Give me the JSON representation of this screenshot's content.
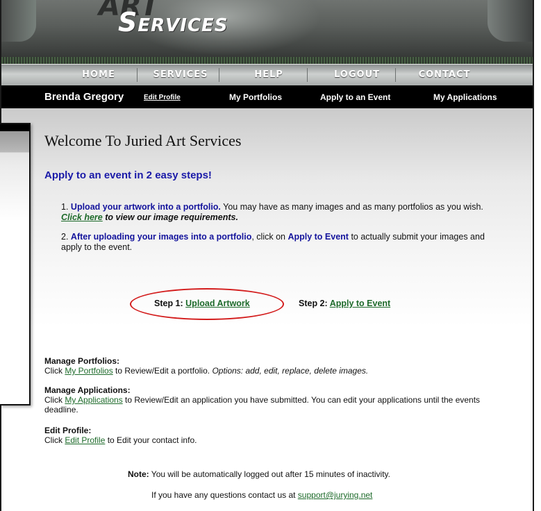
{
  "header": {
    "logo_art": "ART",
    "logo_initial": "S",
    "logo_rest": "ERVICES"
  },
  "nav": {
    "items": [
      {
        "label": "HOME"
      },
      {
        "label": "SERVICES"
      },
      {
        "label": "HELP"
      },
      {
        "label": "LOGOUT"
      },
      {
        "label": "CONTACT"
      }
    ]
  },
  "subnav": {
    "user_name": "Brenda Gregory",
    "edit_profile": "Edit Profile",
    "my_portfolios": "My Portfolios",
    "apply_event": "Apply to an Event",
    "my_applications": "My Applications"
  },
  "main": {
    "title": "Welcome To Juried Art Services",
    "subtitle": "Apply to an event in 2 easy steps!",
    "step1": {
      "num": "1.",
      "bold": "Upload your artwork into a portfolio.",
      "text": " You may have as many images and as many portfolios as you wish. ",
      "link": "Click here",
      "after": " to view our image requirements."
    },
    "step2": {
      "num": "2.",
      "bold": "After uploading your images into a portfolio",
      "text1": ", click on ",
      "bold2": "Apply to Event",
      "text2": " to actually submit your images and apply to the event."
    },
    "steps_row": {
      "step1_label": "Step 1: ",
      "step1_link": "Upload Artwork",
      "step2_label": "Step 2: ",
      "step2_link": "Apply to Event"
    },
    "manage_portfolios": {
      "heading": "Manage Portfolios",
      "pre": "Click ",
      "link": "My Portfolios",
      "post": " to Review/Edit a portfolio. ",
      "options": "Options: add, edit, replace, delete images."
    },
    "manage_applications": {
      "heading": "Manage Applications",
      "pre": "Click ",
      "link": "My Applications",
      "post": " to Review/Edit an application you have submitted. You can edit your  applications until the events deadline."
    },
    "edit_profile": {
      "heading": "Edit Profile",
      "pre": "Click ",
      "link": "Edit Profile",
      "post": " to Edit your contact info."
    },
    "note": {
      "label": "Note:",
      "text": " You will be automatically logged out after 15 minutes of inactivity."
    },
    "contact": {
      "text": "If you have any questions contact us at ",
      "email": "support@jurying.net"
    }
  },
  "colors": {
    "accent_blue": "#14149c",
    "link_green": "#1d6a2a",
    "highlight_red": "#d31b1b"
  }
}
